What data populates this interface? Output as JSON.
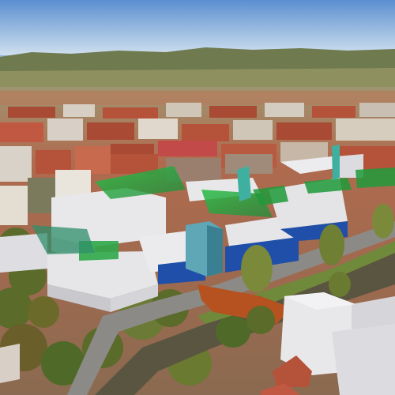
{
  "scene": {
    "kind": "aerial 3D city view",
    "elements": [
      "sky",
      "distant-hills",
      "city-roofs",
      "proposed-white-blocks",
      "green-glass-roofs",
      "glass-tower",
      "orange-plaza",
      "river-canal",
      "trees",
      "road"
    ]
  },
  "colors": {
    "sky_top": "#5b8fd0",
    "sky_bottom": "#cfe0ee",
    "hills": "#6f7a4f",
    "roof_red": "#b5523a",
    "building_white": "#e8e8ea",
    "glass_green": "#2ea043",
    "blue_band": "#1f4fa8",
    "plaza_orange": "#b5521f",
    "canal": "#5a5540",
    "tree": "#5a6b2a"
  }
}
